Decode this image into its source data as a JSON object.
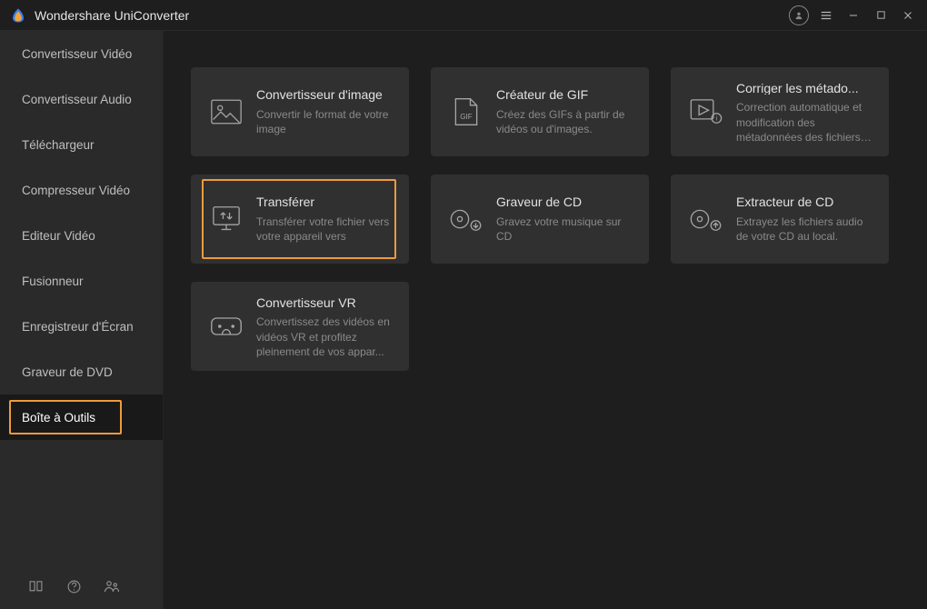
{
  "app": {
    "title": "Wondershare UniConverter"
  },
  "sidebar": {
    "items": [
      {
        "label": "Convertisseur Vidéo"
      },
      {
        "label": "Convertisseur Audio"
      },
      {
        "label": "Téléchargeur"
      },
      {
        "label": "Compresseur Vidéo"
      },
      {
        "label": "Editeur Vidéo"
      },
      {
        "label": "Fusionneur"
      },
      {
        "label": "Enregistreur d'Écran"
      },
      {
        "label": "Graveur de DVD"
      },
      {
        "label": "Boîte à Outils"
      }
    ],
    "active_index": 8
  },
  "tools": [
    {
      "title": "Convertisseur d'image",
      "desc": "Convertir le format de votre image"
    },
    {
      "title": "Créateur de GIF",
      "desc": "Créez des GIFs à partir de vidéos ou d'images."
    },
    {
      "title": "Corriger les métado...",
      "desc": "Correction automatique et modification des métadonnées des fichiers m..."
    },
    {
      "title": "Transférer",
      "desc": "Transférer votre fichier vers votre appareil vers"
    },
    {
      "title": "Graveur de CD",
      "desc": "Gravez votre musique sur CD"
    },
    {
      "title": "Extracteur de CD",
      "desc": "Extrayez les fichiers audio de votre CD au local."
    },
    {
      "title": "Convertisseur VR",
      "desc": "Convertissez des vidéos en vidéos VR et profitez pleinement de vos appar..."
    }
  ],
  "highlighted_card_index": 3
}
